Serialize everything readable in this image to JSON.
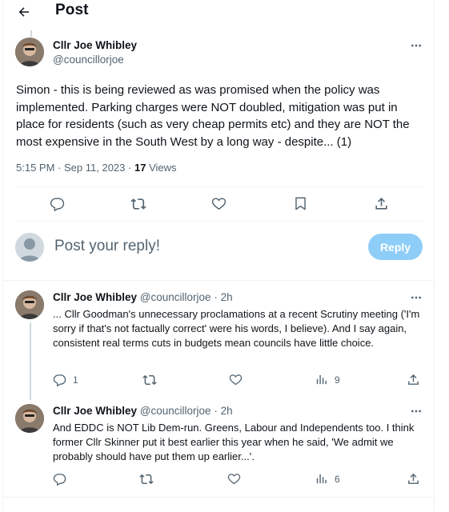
{
  "header": {
    "title": "Post"
  },
  "main_post": {
    "author_name": "Cllr Joe Whibley",
    "author_handle": "@councillorjoe",
    "text": "Simon - this is being reviewed as was promised when the policy was implemented. Parking charges were NOT doubled, mitigation was put in place for residents (such as very cheap permits etc) and they are NOT the most expensive in the South West by a long way - despite... (1)",
    "time": "5:15 PM",
    "date": "Sep 11, 2023",
    "views_count": "17",
    "views_label": "Views"
  },
  "composer": {
    "placeholder": "Post your reply!",
    "reply_button": "Reply"
  },
  "replies": [
    {
      "author_name": "Cllr Joe Whibley",
      "author_handle": "@councillorjoe",
      "age": "2h",
      "text": "... Cllr Goodman's unnecessary proclamations at a recent Scrutiny meeting ('I'm sorry if that's not factually correct' were his words, I believe). And I say again, consistent real terms cuts in budgets mean councils have little choice.",
      "reply_count": "1",
      "views_count": "9"
    },
    {
      "author_name": "Cllr Joe Whibley",
      "author_handle": "@councillorjoe",
      "age": "2h",
      "text": "And EDDC is NOT Lib Dem-run. Greens, Labour and Independents too. I think former Cllr Skinner put it best earlier this year when he said, 'We admit we probably should have put them up earlier...'.",
      "reply_count": "",
      "views_count": "6"
    }
  ],
  "colors": {
    "text": "#0f1419",
    "secondary": "#536471",
    "reply_button_disabled": "#8ecdf8",
    "border": "#eff3f4"
  }
}
